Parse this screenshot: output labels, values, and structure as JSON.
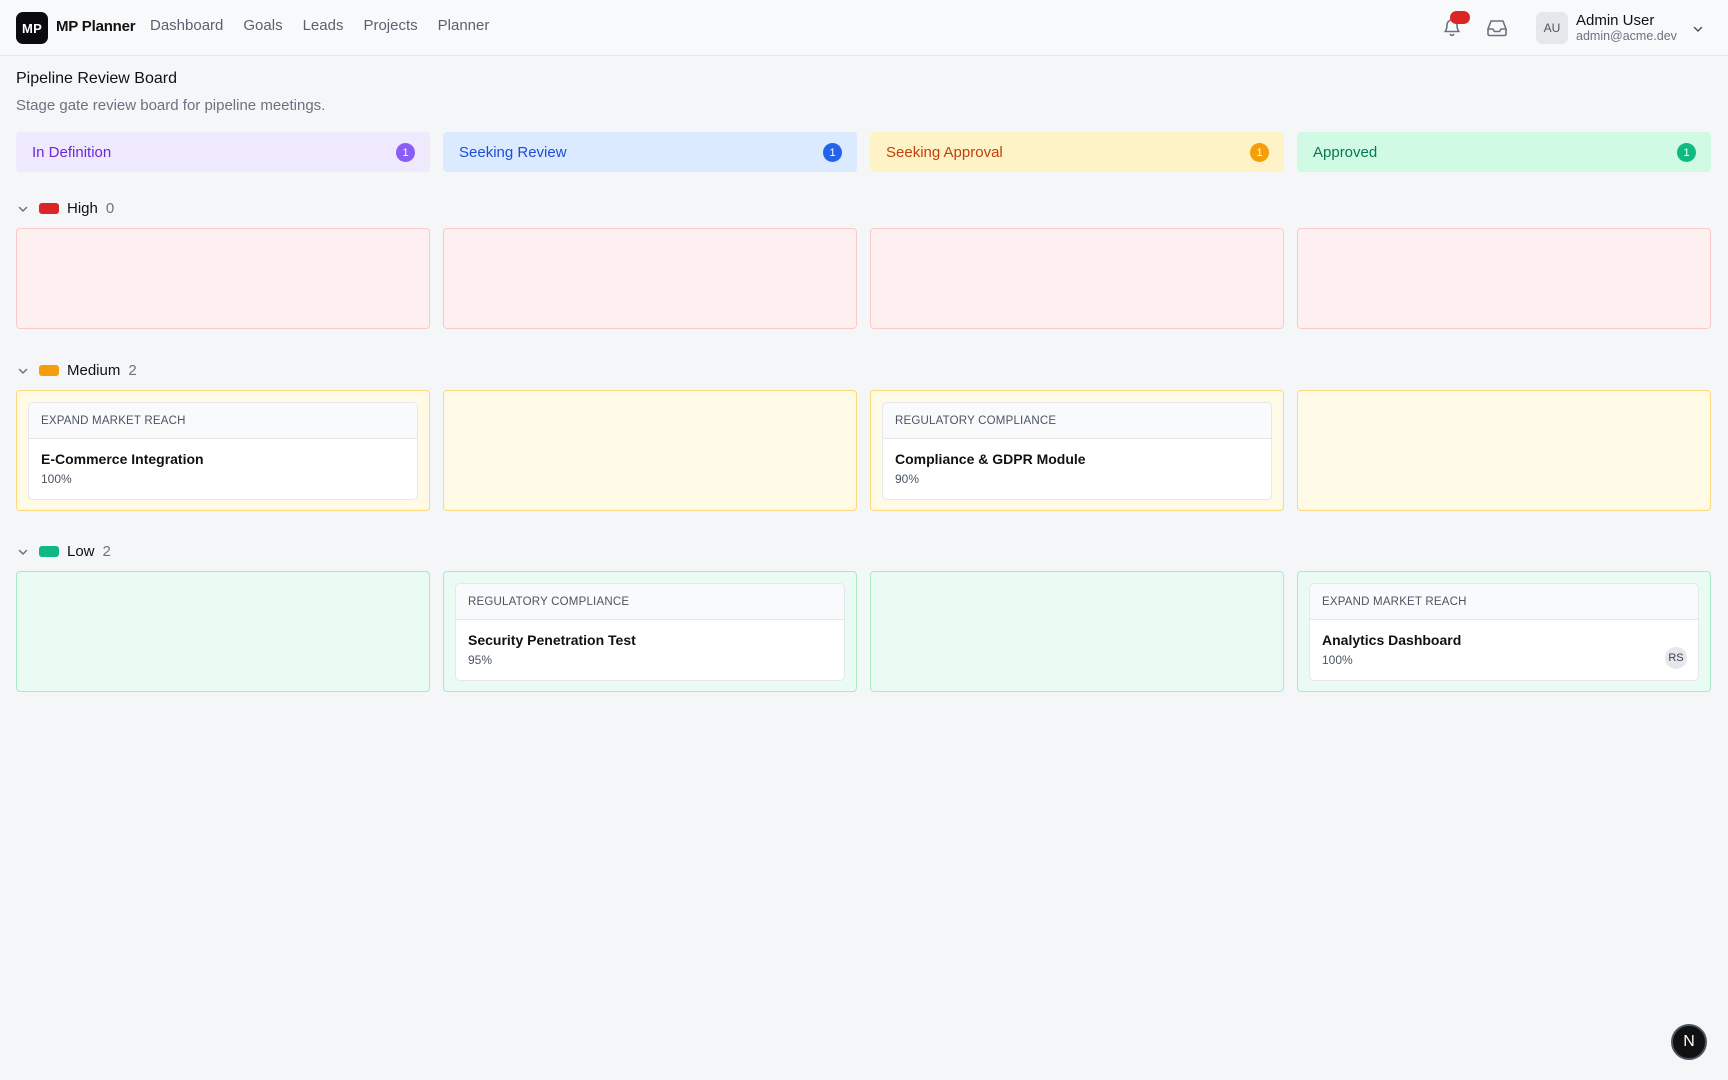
{
  "app": {
    "logo": "MP",
    "name": "MP Planner"
  },
  "nav": [
    "Dashboard",
    "Goals",
    "Leads",
    "Projects",
    "Planner"
  ],
  "user": {
    "initials": "AU",
    "name": "Admin User",
    "email": "admin@acme.dev"
  },
  "page": {
    "title": "Pipeline Review Board",
    "subtitle": "Stage gate review board for pipeline meetings."
  },
  "stages": [
    {
      "label": "In Definition",
      "count": "1",
      "bg": "#efe9fe",
      "text": "#6d28d9",
      "badge": "#8b5cf6"
    },
    {
      "label": "Seeking Review",
      "count": "1",
      "bg": "#dbeafe",
      "text": "#1d4ed8",
      "badge": "#2563eb"
    },
    {
      "label": "Seeking Approval",
      "count": "1",
      "bg": "#fef3c7",
      "text": "#c2410c",
      "badge": "#f59e0b"
    },
    {
      "label": "Approved",
      "count": "1",
      "bg": "#d1fae5",
      "text": "#047857",
      "badge": "#10b981"
    }
  ],
  "groups": [
    {
      "label": "High",
      "count": "0",
      "swatch": "#dc2626",
      "cell_bg": "#fef0f0",
      "cell_border": "#fbc9c9",
      "cells": [
        null,
        null,
        null,
        null
      ]
    },
    {
      "label": "Medium",
      "count": "2",
      "swatch": "#f59e0b",
      "cell_bg": "#fefae6",
      "cell_border": "#fcd97a",
      "cells": [
        {
          "goal": "EXPAND MARKET REACH",
          "title": "E-Commerce Integration",
          "percent": "100%"
        },
        null,
        {
          "goal": "REGULATORY COMPLIANCE",
          "title": "Compliance & GDPR Module",
          "percent": "90%"
        },
        null
      ]
    },
    {
      "label": "Low",
      "count": "2",
      "swatch": "#10b981",
      "cell_bg": "#e9fbf2",
      "cell_border": "#a7ebc9",
      "cells": [
        null,
        {
          "goal": "REGULATORY COMPLIANCE",
          "title": "Security Penetration Test",
          "percent": "95%"
        },
        null,
        {
          "goal": "EXPAND MARKET REACH",
          "title": "Analytics Dashboard",
          "percent": "100%",
          "assignee": "RS"
        }
      ]
    }
  ],
  "fab": {
    "label": "N"
  },
  "icons": {
    "bell": "bell-icon",
    "inbox": "inbox-icon",
    "chevron": "chevron-down-icon"
  }
}
